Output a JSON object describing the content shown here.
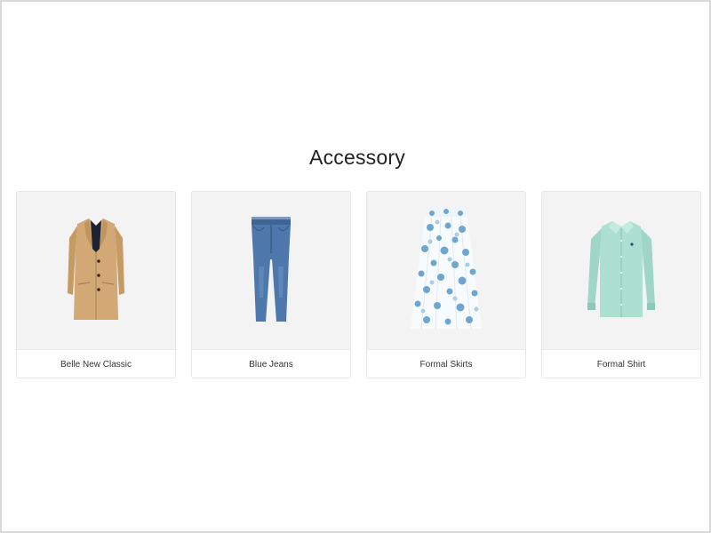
{
  "section": {
    "title": "Accessory"
  },
  "products": [
    {
      "name": "Belle New Classic",
      "icon": "coat-image",
      "color": "#c8a06e"
    },
    {
      "name": "Blue Jeans",
      "icon": "jeans-image",
      "color": "#4f79ad"
    },
    {
      "name": "Formal Skirts",
      "icon": "floral-skirt-image",
      "color": "#6fa6cf"
    },
    {
      "name": "Formal Shirt",
      "icon": "shirt-image",
      "color": "#a9dccd"
    }
  ]
}
